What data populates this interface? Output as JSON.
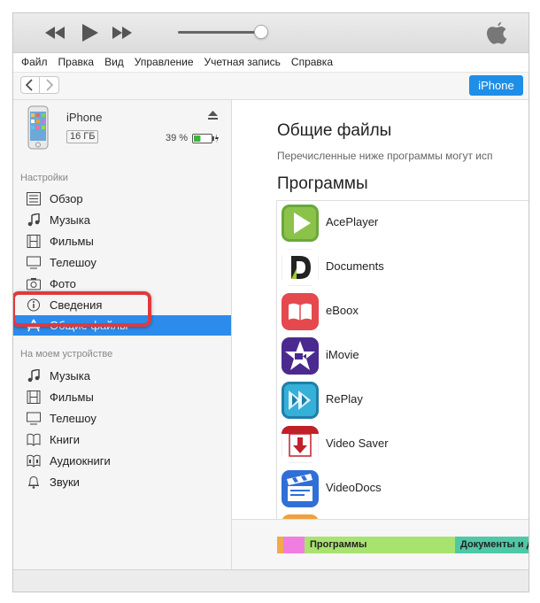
{
  "menu": [
    "Файл",
    "Правка",
    "Вид",
    "Управление",
    "Учетная запись",
    "Справка"
  ],
  "nav": {
    "device_button": "iPhone"
  },
  "device": {
    "name": "iPhone",
    "capacity": "16 ГБ",
    "battery": "39 %",
    "battery_level": 0.39
  },
  "sidebar": {
    "settings_label": "Настройки",
    "settings_items": [
      {
        "label": "Обзор",
        "icon": "list-icon"
      },
      {
        "label": "Музыка",
        "icon": "music-note-icon"
      },
      {
        "label": "Фильмы",
        "icon": "film-icon"
      },
      {
        "label": "Телешоу",
        "icon": "tv-icon"
      },
      {
        "label": "Фото",
        "icon": "camera-icon"
      },
      {
        "label": "Сведения",
        "icon": "info-icon"
      },
      {
        "label": "Общие файлы",
        "icon": "app-store-icon",
        "selected": true
      }
    ],
    "device_label": "На моем устройстве",
    "device_items": [
      {
        "label": "Музыка",
        "icon": "music-note-icon"
      },
      {
        "label": "Фильмы",
        "icon": "film-icon"
      },
      {
        "label": "Телешоу",
        "icon": "tv-icon"
      },
      {
        "label": "Книги",
        "icon": "book-icon"
      },
      {
        "label": "Аудиокниги",
        "icon": "audiobook-icon"
      },
      {
        "label": "Звуки",
        "icon": "bell-icon"
      }
    ]
  },
  "main": {
    "title": "Общие файлы",
    "description": "Перечисленные ниже программы могут исп",
    "apps_title": "Программы",
    "apps": [
      {
        "name": "AcePlayer",
        "icon": "play-icon"
      },
      {
        "name": "Documents",
        "icon": "documents-d-icon"
      },
      {
        "name": "eBoox",
        "icon": "book-icon"
      },
      {
        "name": "iMovie",
        "icon": "star-camera-icon"
      },
      {
        "name": "RePlay",
        "icon": "replay-icon"
      },
      {
        "name": "Video Saver",
        "icon": "download-arrow-icon"
      },
      {
        "name": "VideoDocs",
        "icon": "clapperboard-icon"
      }
    ]
  },
  "storage": {
    "segments": [
      {
        "label": "",
        "color": "#f2a94a"
      },
      {
        "label": "",
        "color": "#f07ee0"
      },
      {
        "label": "Программы",
        "color": "#a9e36f"
      },
      {
        "label": "Документы и д",
        "color": "#4fc8a6"
      }
    ]
  },
  "colors": {
    "accent": "#2d8ceb",
    "highlight_border": "#e0393e"
  }
}
